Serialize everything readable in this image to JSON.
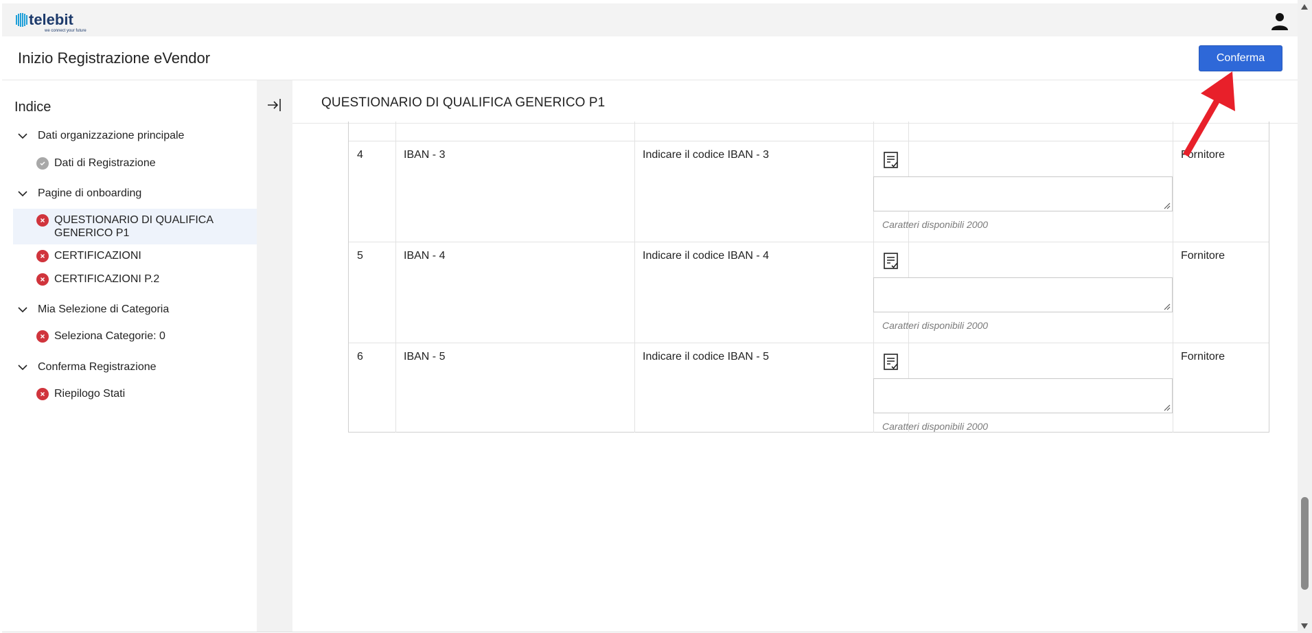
{
  "app": {
    "logo_text": "telebit",
    "logo_tagline": "we connect your future"
  },
  "header": {
    "title": "Inizio Registrazione eVendor",
    "confirm_label": "Conferma"
  },
  "sidebar": {
    "title": "Indice",
    "sections": [
      {
        "label": "Dati organizzazione principale",
        "items": [
          {
            "label": "Dati di Registrazione",
            "status": "ok"
          }
        ]
      },
      {
        "label": "Pagine di onboarding",
        "items": [
          {
            "label_line1": "QUESTIONARIO DI QUALIFICA",
            "label_line2": "GENERICO P1",
            "status": "error",
            "active": true
          },
          {
            "label": "CERTIFICAZIONI",
            "status": "error"
          },
          {
            "label": "CERTIFICAZIONI P.2",
            "status": "error"
          }
        ]
      },
      {
        "label": "Mia Selezione di Categoria",
        "items": [
          {
            "label": "Seleziona Categorie: 0",
            "status": "error"
          }
        ]
      },
      {
        "label": "Conferma Registrazione",
        "items": [
          {
            "label": "Riepilogo Stati",
            "status": "error"
          }
        ]
      }
    ]
  },
  "main": {
    "title": "QUESTIONARIO DI QUALIFICA GENERICO P1",
    "rows": [
      {
        "num": "4",
        "name": "IBAN - 3",
        "question": "Indicare il codice IBAN - 3",
        "chars_note": "Caratteri disponibili 2000",
        "owner": "Fornitore"
      },
      {
        "num": "5",
        "name": "IBAN - 4",
        "question": "Indicare il codice IBAN - 4",
        "chars_note": "Caratteri disponibili 2000",
        "owner": "Fornitore"
      },
      {
        "num": "6",
        "name": "IBAN - 5",
        "question": "Indicare il codice IBAN - 5",
        "chars_note": "Caratteri disponibili 2000",
        "owner": "Fornitore"
      }
    ]
  },
  "colors": {
    "accent": "#2e68d8",
    "error": "#d0343c",
    "ok": "#a8a8a8",
    "arrow": "#e8202a"
  }
}
